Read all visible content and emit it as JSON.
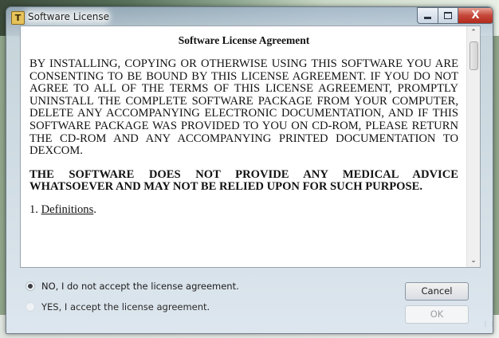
{
  "window": {
    "title": "Software License",
    "app_icon_letter": "T"
  },
  "caption_buttons": {
    "close_glyph": "X"
  },
  "license": {
    "heading": "Software License Agreement",
    "paragraph1": "BY INSTALLING, COPYING OR OTHERWISE USING THIS SOFTWARE YOU ARE CONSENTING TO BE BOUND BY THIS LICENSE AGREEMENT. IF YOU DO NOT AGREE TO ALL OF THE TERMS OF THIS LICENSE AGREEMENT, PROMPTLY UNINSTALL THE COMPLETE SOFTWARE PACKAGE FROM YOUR COMPUTER, DELETE ANY ACCOMPANYING ELECTRONIC DOCUMENTATION, AND IF THIS SOFTWARE PACKAGE WAS PROVIDED TO YOU ON CD-ROM, PLEASE RETURN THE CD-ROM AND ANY ACCOMPANYING PRINTED DOCUMENTATION TO DEXCOM.",
    "paragraph2": "THE SOFTWARE DOES NOT PROVIDE ANY MEDICAL ADVICE WHATSOEVER AND MAY NOT BE RELIED UPON FOR SUCH PURPOSE.",
    "section_number": "1.",
    "section_title": "Definitions",
    "section_end": "."
  },
  "options": {
    "decline_label": "NO, I do not accept the license agreement.",
    "accept_label": "YES, I accept the license agreement.",
    "selected": "decline"
  },
  "buttons": {
    "cancel_label": "Cancel",
    "ok_label": "OK"
  }
}
